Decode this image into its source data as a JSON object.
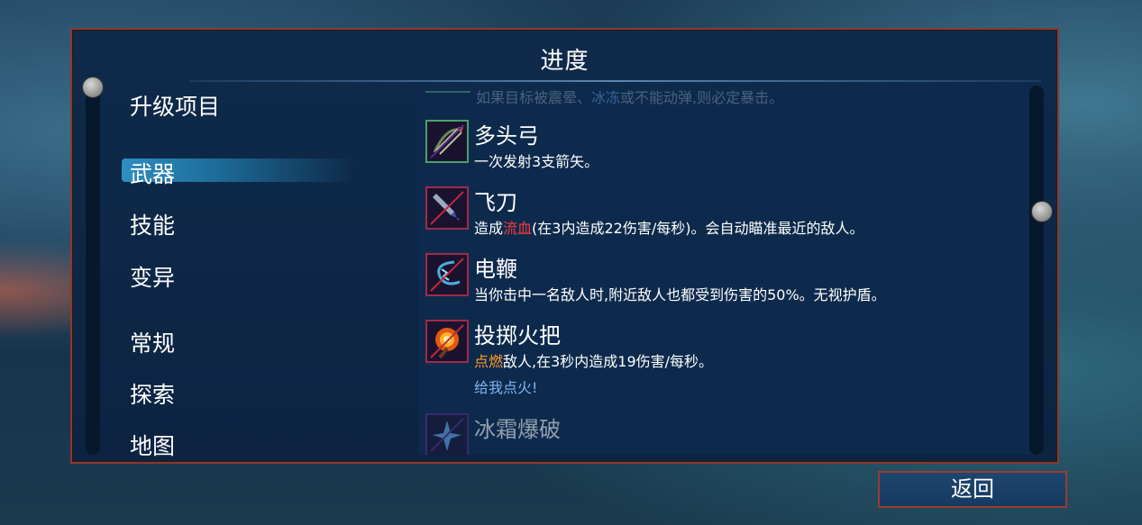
{
  "panel": {
    "title": "进度"
  },
  "categories": [
    {
      "label": "升级项目",
      "selected": false
    },
    {
      "label": "武器",
      "selected": true
    },
    {
      "label": "技能",
      "selected": false
    },
    {
      "label": "变异",
      "selected": false
    },
    {
      "label": "常规",
      "selected": false
    },
    {
      "label": "探索",
      "selected": false
    },
    {
      "label": "地图",
      "selected": false
    }
  ],
  "partial_top": {
    "text_a": "如果目标被震晕、",
    "text_b": "冰冻",
    "text_c": "或不能动弹,则必定暴击。"
  },
  "items": [
    {
      "name": "多头弓",
      "icon": "multi-bow-icon",
      "desc_a": "一次发射3支箭矢。",
      "desc_b": "",
      "desc_c": ""
    },
    {
      "name": "飞刀",
      "icon": "throwing-knife-icon",
      "desc_a": "造成",
      "desc_b": "流血",
      "desc_c": "(在3内造成22伤害/每秒)。会自动瞄准最近的敌人。"
    },
    {
      "name": "电鞭",
      "icon": "electric-whip-icon",
      "desc_a": "当你击中一名敌人时,附近敌人也都受到伤害的50%。无视护盾。",
      "desc_b": "",
      "desc_c": ""
    },
    {
      "name": "投掷火把",
      "icon": "throwing-torch-icon",
      "desc_a": "",
      "desc_b": "点燃",
      "desc_c": "敌人,在3秒内造成19伤害/每秒。",
      "flavor": "给我点火!"
    },
    {
      "name": "冰霜爆破",
      "icon": "frost-blast-icon"
    }
  ],
  "back_button": {
    "label": "返回"
  },
  "colors": {
    "panel_border": "#8a3a2e",
    "panel_bg": "#0f2a4a",
    "bleed": "#ff3a3a",
    "burn": "#ff9a2a",
    "flavor": "#7fb6f0",
    "selected": "#2f8fc0"
  }
}
